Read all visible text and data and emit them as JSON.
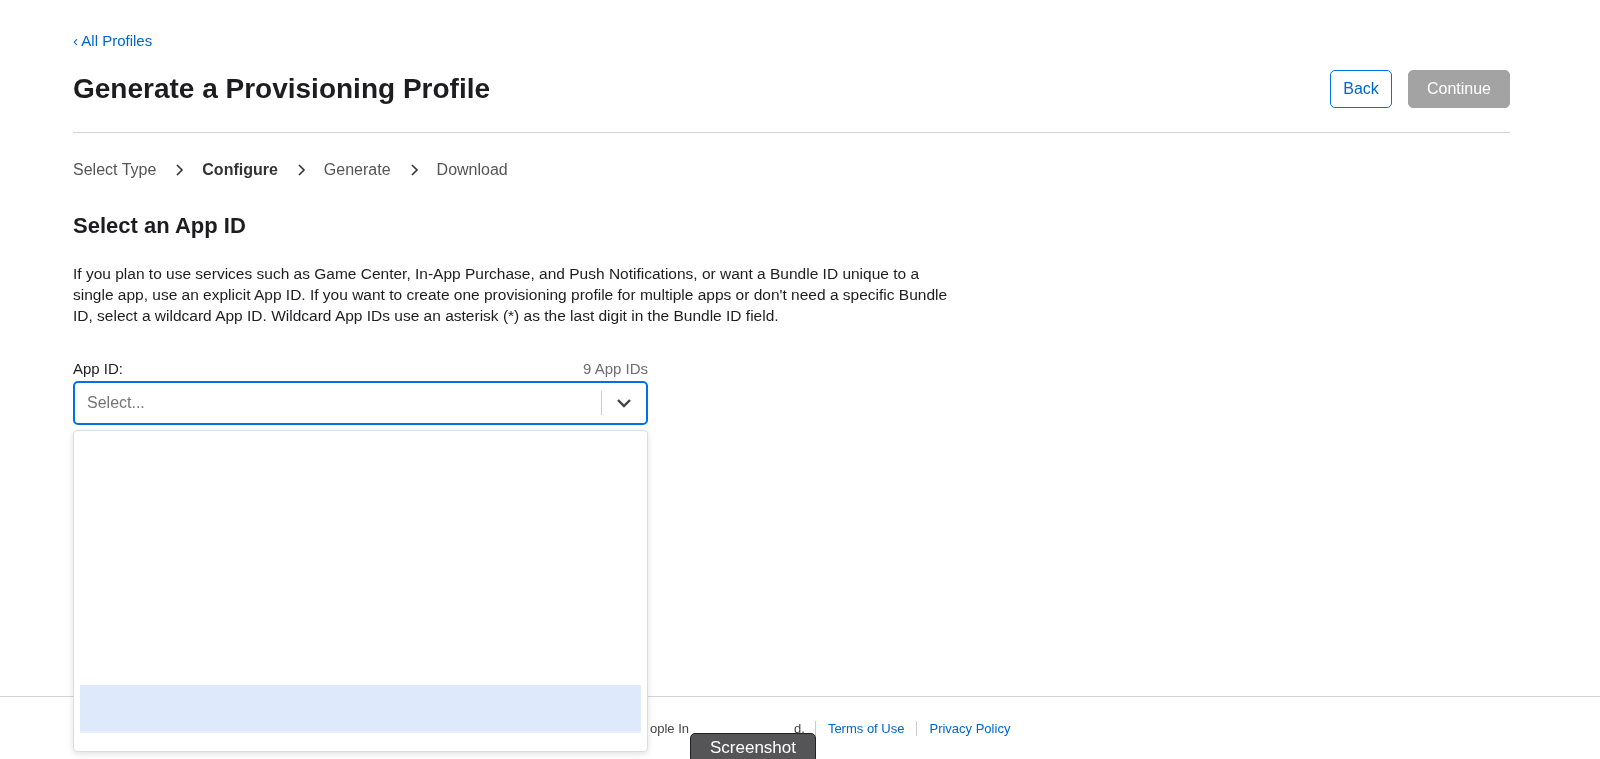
{
  "back_link": {
    "icon": "‹",
    "label": "All Profiles"
  },
  "title": "Generate a Provisioning Profile",
  "buttons": [
    {
      "label": "Back",
      "disabled": false
    },
    {
      "label": "Continue",
      "disabled": true
    }
  ],
  "steps": [
    {
      "label": "Select Type",
      "selected": false
    },
    {
      "label": "Configure",
      "selected": true
    },
    {
      "label": "Generate",
      "selected": false
    },
    {
      "label": "Download",
      "selected": false
    }
  ],
  "section_title": "Select an App ID",
  "description": "If you plan to use services such as Game Center, In-App Purchase, and Push Notifications, or want a Bundle ID unique to a single app, use an explicit App ID. If you want to create one provisioning profile for multiple apps or don't need a specific Bundle ID, select a wildcard App ID. Wildcard App IDs use an asterisk (*) as the last digit in the Bundle ID field.",
  "field": {
    "label": "App ID:",
    "count": "9 App IDs",
    "placeholder": "Select...",
    "expanded": true
  },
  "footer": {
    "copyright_fragments": [
      "ople In",
      "d."
    ],
    "links": [
      "Terms of Use",
      "Privacy Policy"
    ]
  },
  "tooltip": "Screenshot"
}
